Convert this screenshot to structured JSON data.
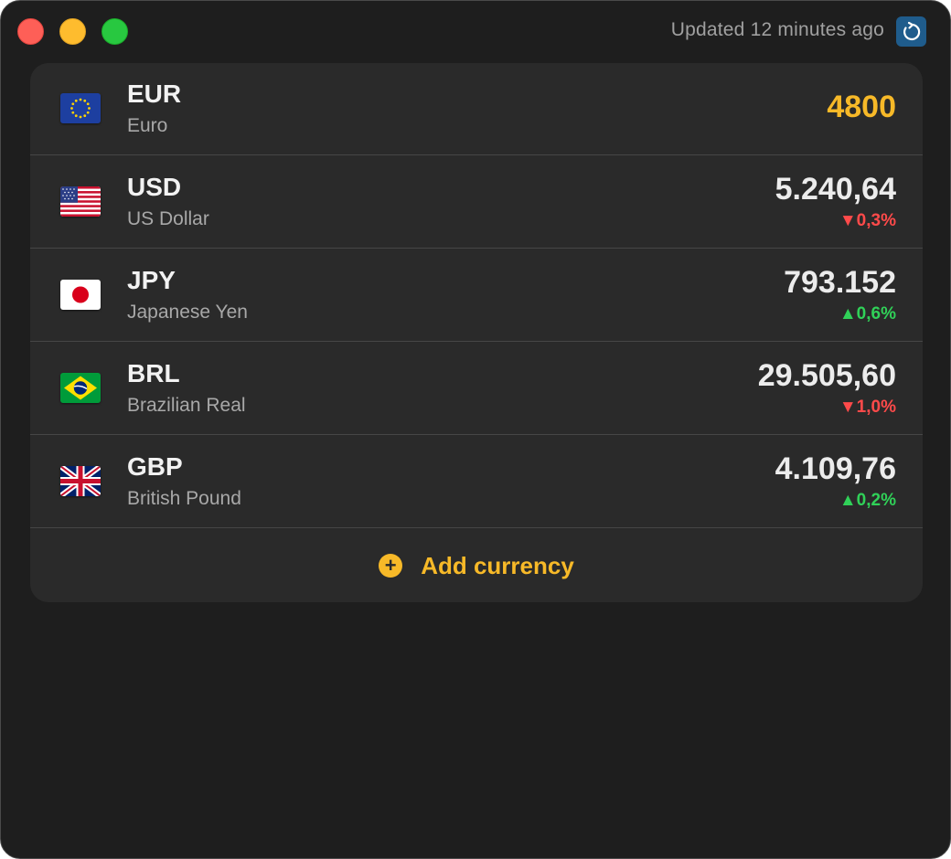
{
  "window": {
    "updated_text": "Updated 12 minutes ago"
  },
  "colors": {
    "accent": "#f7b928",
    "down": "#ff4a4a",
    "up": "#30d158",
    "background": "#1e1e1e",
    "panel": "#2a2a2a"
  },
  "currencies": [
    {
      "code": "EUR",
      "name": "Euro",
      "value": "4800",
      "change": "",
      "flag_icon": "eu-flag-icon"
    },
    {
      "code": "USD",
      "name": "US Dollar",
      "value": "5.240,64",
      "change": "▼0,3%",
      "direction": "down",
      "flag_icon": "us-flag-icon"
    },
    {
      "code": "JPY",
      "name": "Japanese Yen",
      "value": "793.152",
      "change": "▲0,6%",
      "direction": "up",
      "flag_icon": "jp-flag-icon"
    },
    {
      "code": "BRL",
      "name": "Brazilian Real",
      "value": "29.505,60",
      "change": "▼1,0%",
      "direction": "down",
      "flag_icon": "br-flag-icon"
    },
    {
      "code": "GBP",
      "name": "British Pound",
      "value": "4.109,76",
      "change": "▲0,2%",
      "direction": "up",
      "flag_icon": "gb-flag-icon"
    }
  ],
  "add_button": {
    "label": "Add currency",
    "icon": "plus-circle-icon"
  }
}
